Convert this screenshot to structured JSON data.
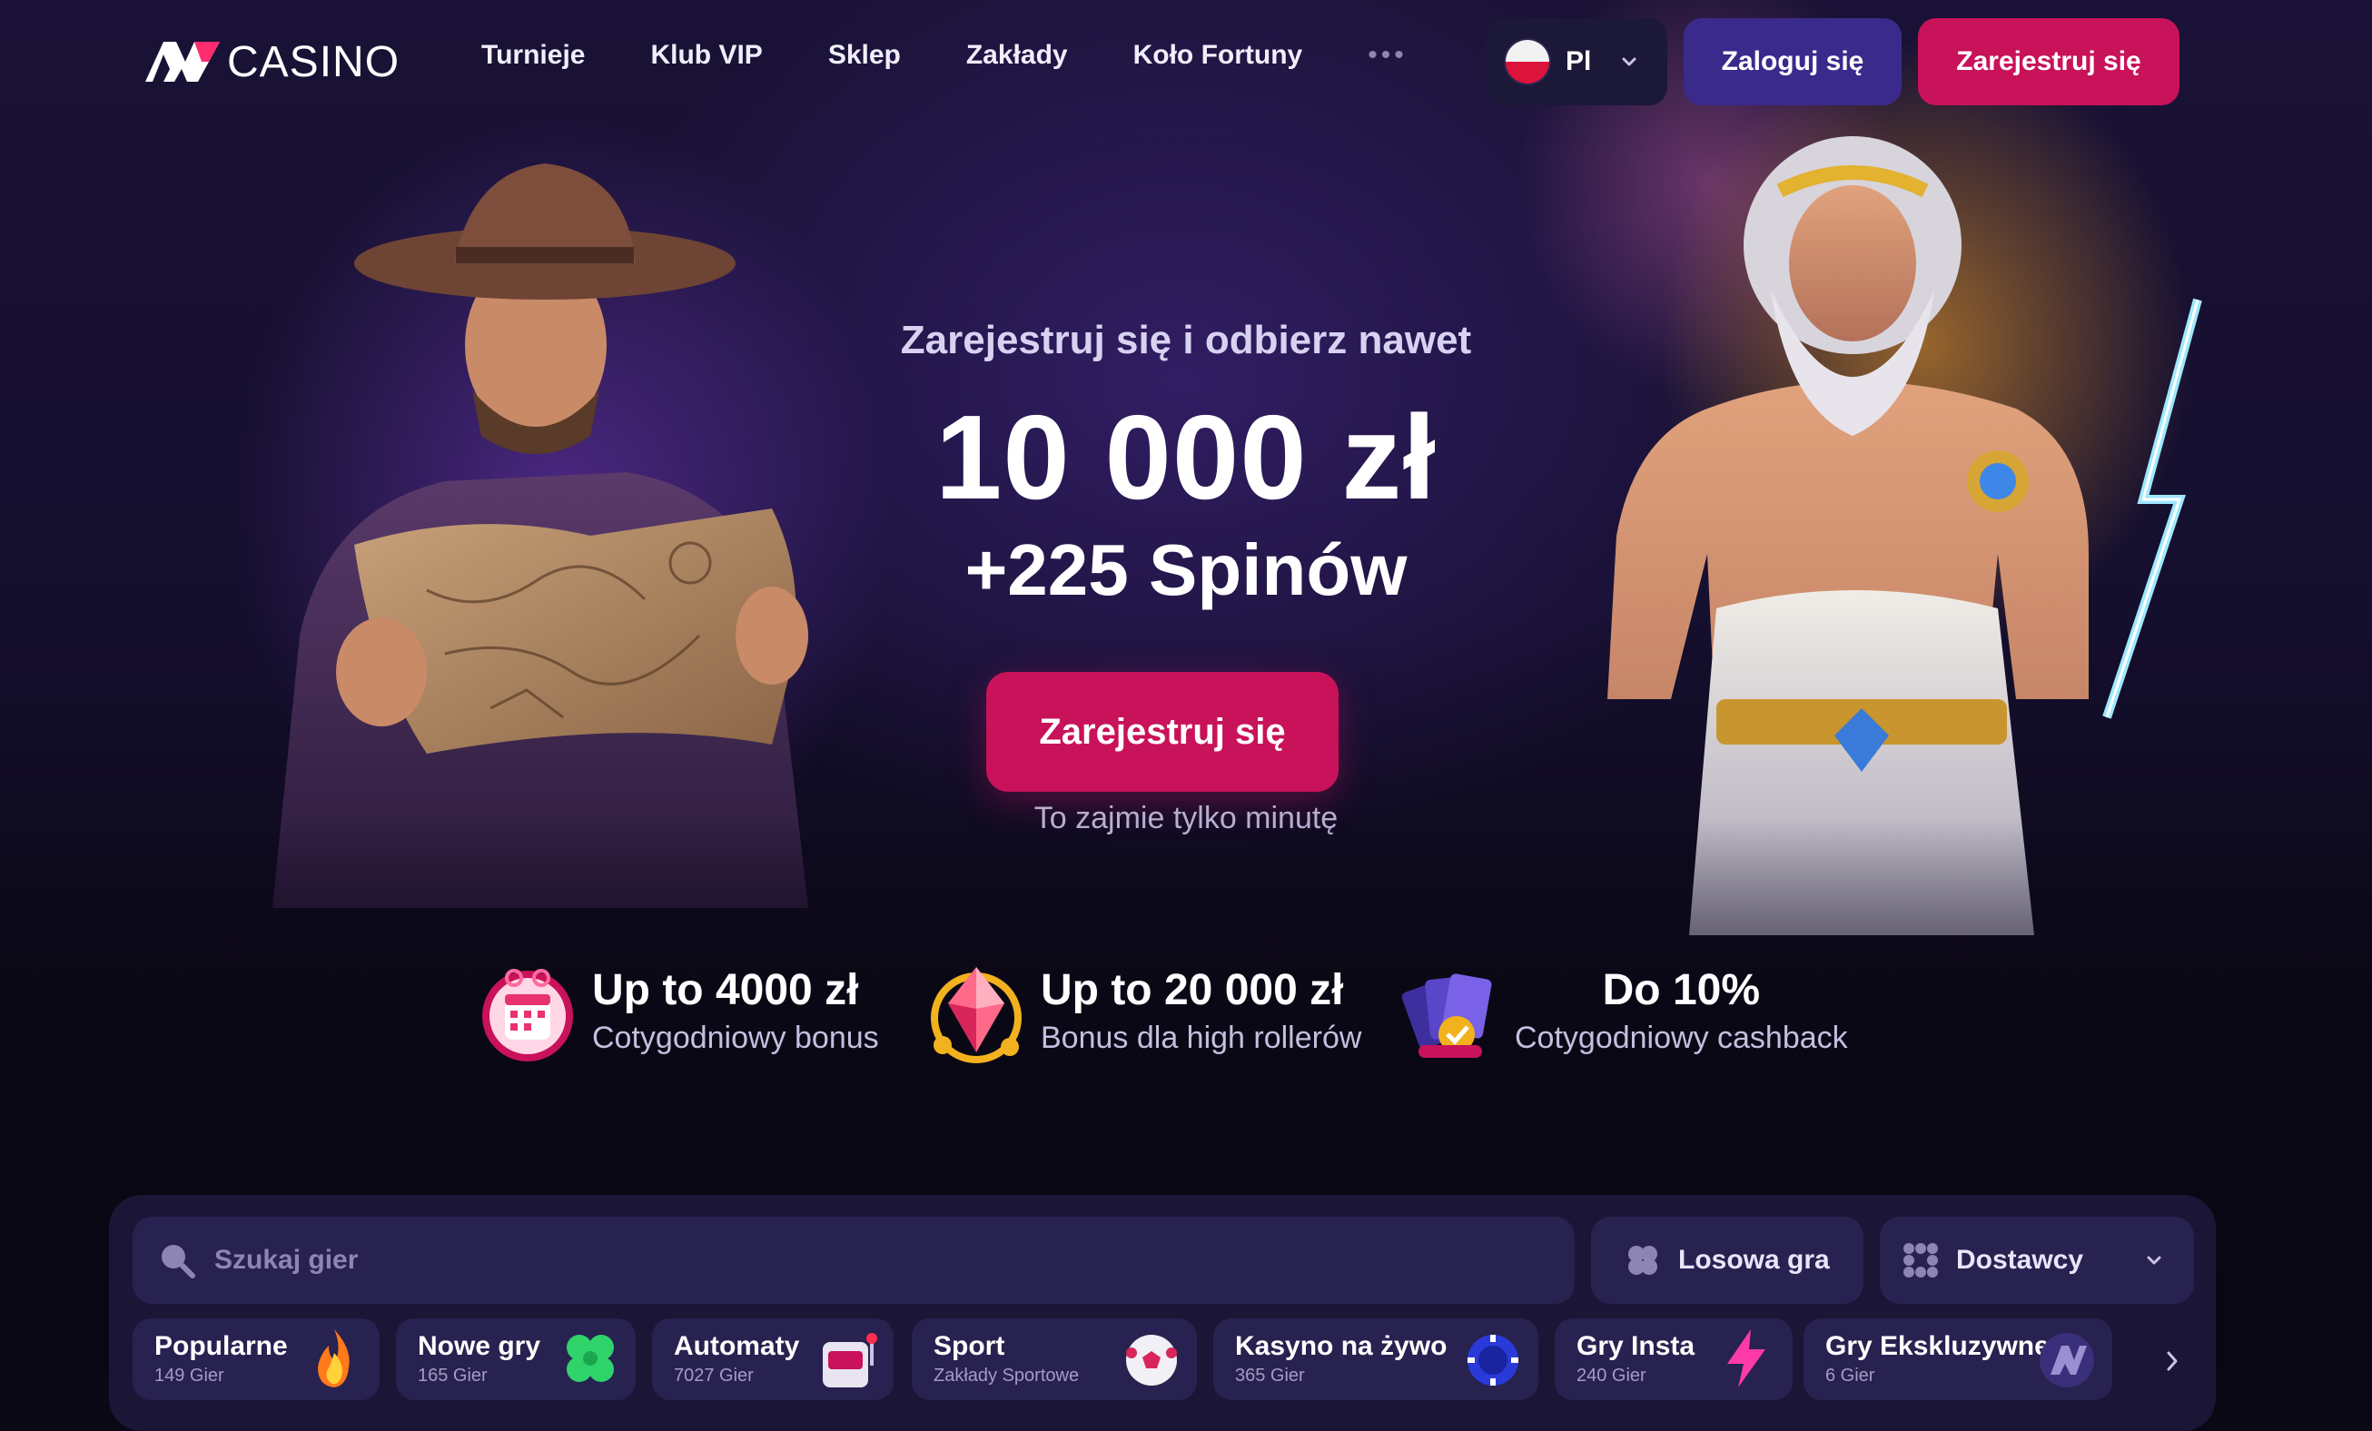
{
  "header": {
    "logo_text": "CASINO",
    "nav": [
      "Turnieje",
      "Klub VIP",
      "Sklep",
      "Zakłady",
      "Koło Fortuny"
    ],
    "more": "•••",
    "language": "Pl",
    "login_label": "Zaloguj się",
    "register_label": "Zarejestruj się"
  },
  "hero": {
    "subtitle": "Zarejestruj się i odbierz nawet",
    "amount": "10 000 zł",
    "spins": "+225 Spinów",
    "cta_label": "Zarejestruj się",
    "note": "To zajmie tylko minutę"
  },
  "features": [
    {
      "title": "Up to 4000 zł",
      "desc": "Cotygodniowy bonus",
      "icon": "calendar-icon"
    },
    {
      "title": "Up to 20 000 zł",
      "desc": "Bonus dla high rollerów",
      "icon": "gem-icon"
    },
    {
      "title": "Do 10%",
      "desc": "Cotygodniowy cashback",
      "icon": "cards-icon"
    }
  ],
  "games": {
    "search_placeholder": "Szukaj gier",
    "random_label": "Losowa gra",
    "providers_label": "Dostawcy",
    "categories": [
      {
        "label": "Popularne",
        "count": "149 Gier",
        "icon": "fire-icon"
      },
      {
        "label": "Nowe gry",
        "count": "165 Gier",
        "icon": "clover-icon"
      },
      {
        "label": "Automaty",
        "count": "7027 Gier",
        "icon": "slot-machine-icon"
      },
      {
        "label": "Sport",
        "count": "Zakłady Sportowe",
        "icon": "soccer-ball-icon"
      },
      {
        "label": "Kasyno na żywo",
        "count": "365 Gier",
        "icon": "poker-chip-icon"
      },
      {
        "label": "Gry Insta",
        "count": "240 Gier",
        "icon": "lightning-icon"
      },
      {
        "label": "Gry Ekskluzywne",
        "count": "6 Gier",
        "icon": "av-logo-icon"
      }
    ]
  },
  "colors": {
    "accent": "#c8125a",
    "login": "#3a2a8c",
    "panel": "#1b1636",
    "field": "#272250"
  }
}
